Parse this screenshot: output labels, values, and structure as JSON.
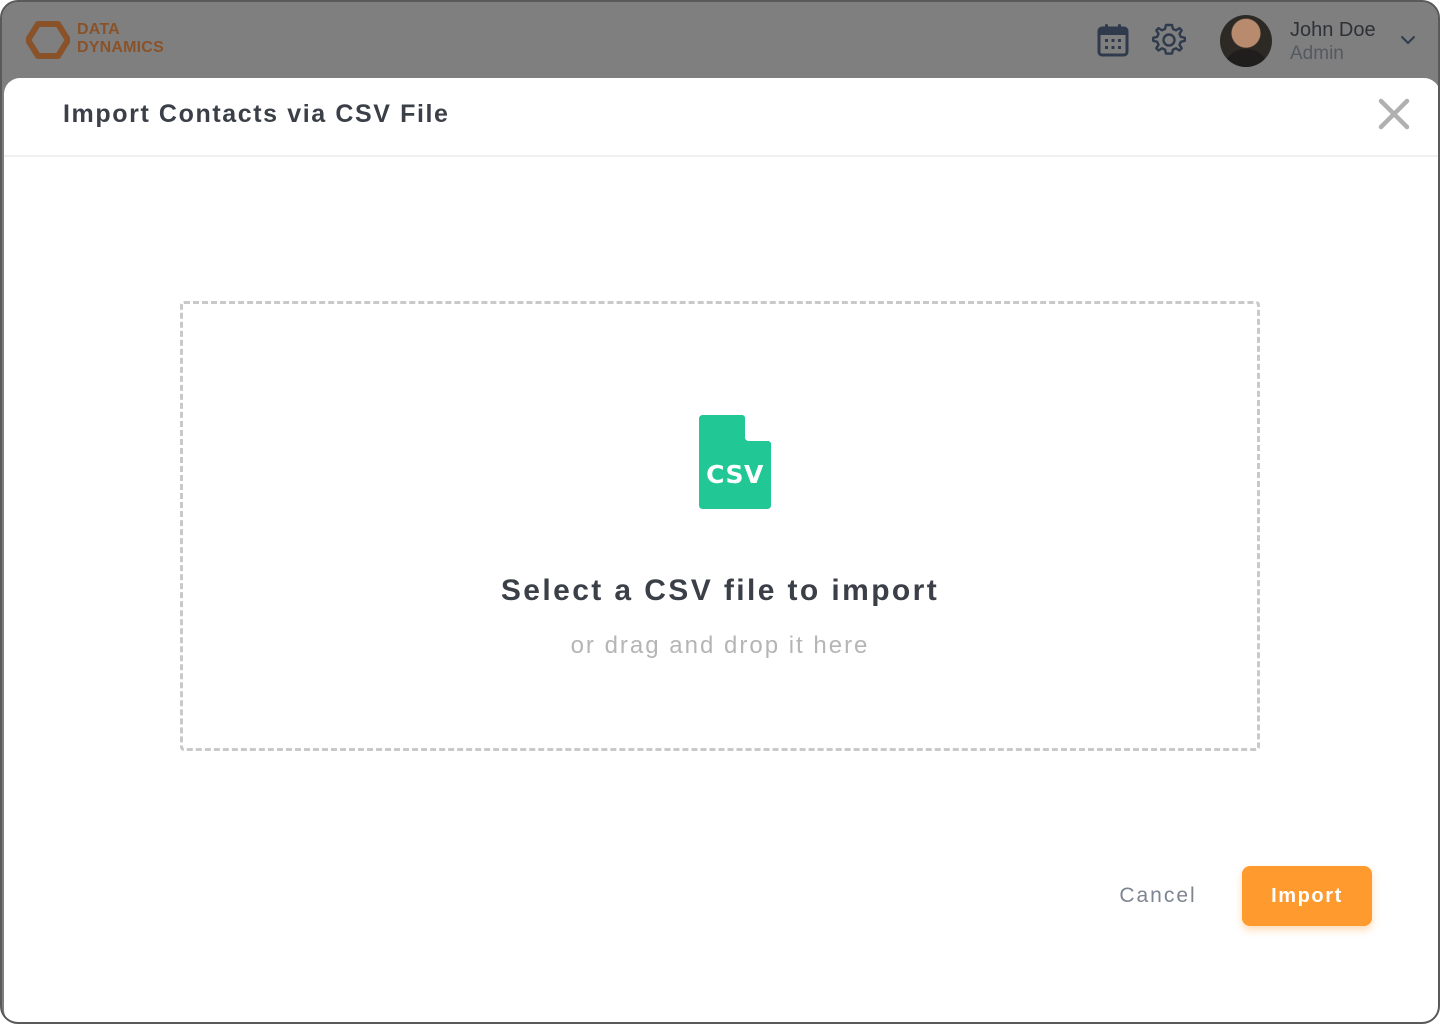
{
  "app": {
    "logo_line1": "DATA",
    "logo_line2": "DYNAMICS",
    "logo_color": "#8a5228"
  },
  "header": {
    "calendar_icon": "calendar-icon",
    "settings_icon": "gear-icon",
    "user": {
      "name": "John Doe",
      "role": "Admin"
    }
  },
  "modal": {
    "title": "Import Contacts via CSV File",
    "dropzone": {
      "icon_label": "CSV",
      "icon_color": "#21c896",
      "title": "Select a CSV file to import",
      "subtitle": "or drag and drop it here"
    },
    "actions": {
      "cancel_label": "Cancel",
      "import_label": "Import",
      "import_color": "#ff9a2e"
    }
  }
}
